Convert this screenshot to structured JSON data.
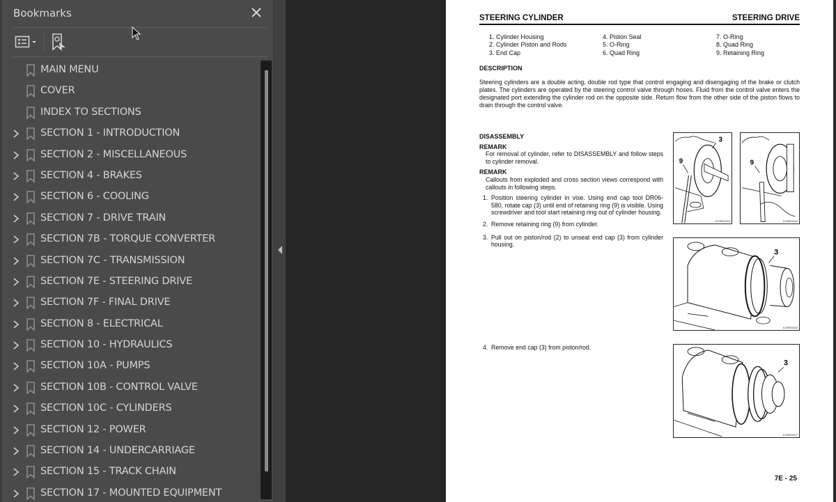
{
  "bookmarks_panel": {
    "title": "Bookmarks",
    "close_icon": "close-icon",
    "toolbar": {
      "options_icon": "list-options-icon",
      "find_bookmark_icon": "find-current-bookmark-icon"
    },
    "items": [
      {
        "label": "MAIN MENU",
        "expandable": false
      },
      {
        "label": "COVER",
        "expandable": false
      },
      {
        "label": "INDEX TO SECTIONS",
        "expandable": false
      },
      {
        "label": "SECTION 1 - INTRODUCTION",
        "expandable": true
      },
      {
        "label": "SECTION 2 - MISCELLANEOUS",
        "expandable": true
      },
      {
        "label": "SECTION 4 - BRAKES",
        "expandable": true
      },
      {
        "label": "SECTION 6 - COOLING",
        "expandable": true
      },
      {
        "label": "SECTION 7 - DRIVE TRAIN",
        "expandable": true
      },
      {
        "label": "SECTION 7B - TORQUE CONVERTER",
        "expandable": true
      },
      {
        "label": "SECTION 7C - TRANSMISSION",
        "expandable": true
      },
      {
        "label": "SECTION 7E - STEERING DRIVE",
        "expandable": true
      },
      {
        "label": "SECTION 7F - FINAL DRIVE",
        "expandable": true
      },
      {
        "label": "SECTION 8 - ELECTRICAL",
        "expandable": true
      },
      {
        "label": "SECTION 10 - HYDRAULICS",
        "expandable": true
      },
      {
        "label": "SECTION 10A - PUMPS",
        "expandable": true
      },
      {
        "label": "SECTION 10B - CONTROL VALVE",
        "expandable": true
      },
      {
        "label": "SECTION 10C - CYLINDERS",
        "expandable": true
      },
      {
        "label": "SECTION 12 - POWER",
        "expandable": true
      },
      {
        "label": "SECTION 14 - UNDERCARRIAGE",
        "expandable": true
      },
      {
        "label": "SECTION 15 - TRACK CHAIN",
        "expandable": true
      },
      {
        "label": "SECTION 17 - MOUNTED EQUIPMENT",
        "expandable": true
      }
    ]
  },
  "splitter": {
    "collapse_icon": "collapse-left-icon"
  },
  "document": {
    "header_left": "STEERING CYLINDER",
    "header_right": "STEERING DRIVE",
    "parts": [
      [
        "1. Cylinder Housing",
        "2. Cylinder Piston and Rods",
        "3. End Cap"
      ],
      [
        "4. Piston Seal",
        "5. O-Ring",
        "6. Quad Ring"
      ],
      [
        "7. O-Ring",
        "8. Quad Ring",
        "9. Retaining Ring"
      ]
    ],
    "description_heading": "DESCRIPTION",
    "description": "Steering cylinders are a double acting, double rod type that control engaging and disengaging of the brake or clutch plates. The cylinders are operated by the steering control valve through hoses. Fluid from the control valve enters the designated port extending the cylinder rod on the opposite side. Return flow from the other side of the piston flows to drain through the control valve.",
    "disassembly_heading": "DISASSEMBLY",
    "remarks": [
      {
        "title": "REMARK",
        "text": "For removal of cylinder, refer to DISASSEMBLY and follow steps to cylinder removal."
      },
      {
        "title": "REMARK",
        "text": "Callouts from exploded and cross section views correspond with callouts in following steps."
      }
    ],
    "steps": [
      {
        "n": "1.",
        "text": "Position steering cylinder in vise. Using end cap tool DR06-580, rotate cap (3) until end of retaining ring (9) is visible. Using screwdriver and tool start retaining ring out of cylinder housing."
      },
      {
        "n": "2.",
        "text": "Remove retaining ring (9) from cylinder."
      },
      {
        "n": "3.",
        "text": "Pull out on piston/rod (2) to unseat end cap (3) from cylinder housing."
      },
      {
        "n": "4.",
        "text": "Remove end cap (3) from piston/rod."
      }
    ],
    "figures": [
      {
        "callouts": [
          "3",
          "9"
        ],
        "id": "KCRW1016"
      },
      {
        "callouts": [
          "9"
        ],
        "id": "KCRW1015"
      },
      {
        "callouts": [
          "3"
        ],
        "id": "KCRW1016"
      },
      {
        "callouts": [
          "3"
        ],
        "id": "KCRW1017"
      }
    ],
    "page_number": "7E - 25"
  }
}
